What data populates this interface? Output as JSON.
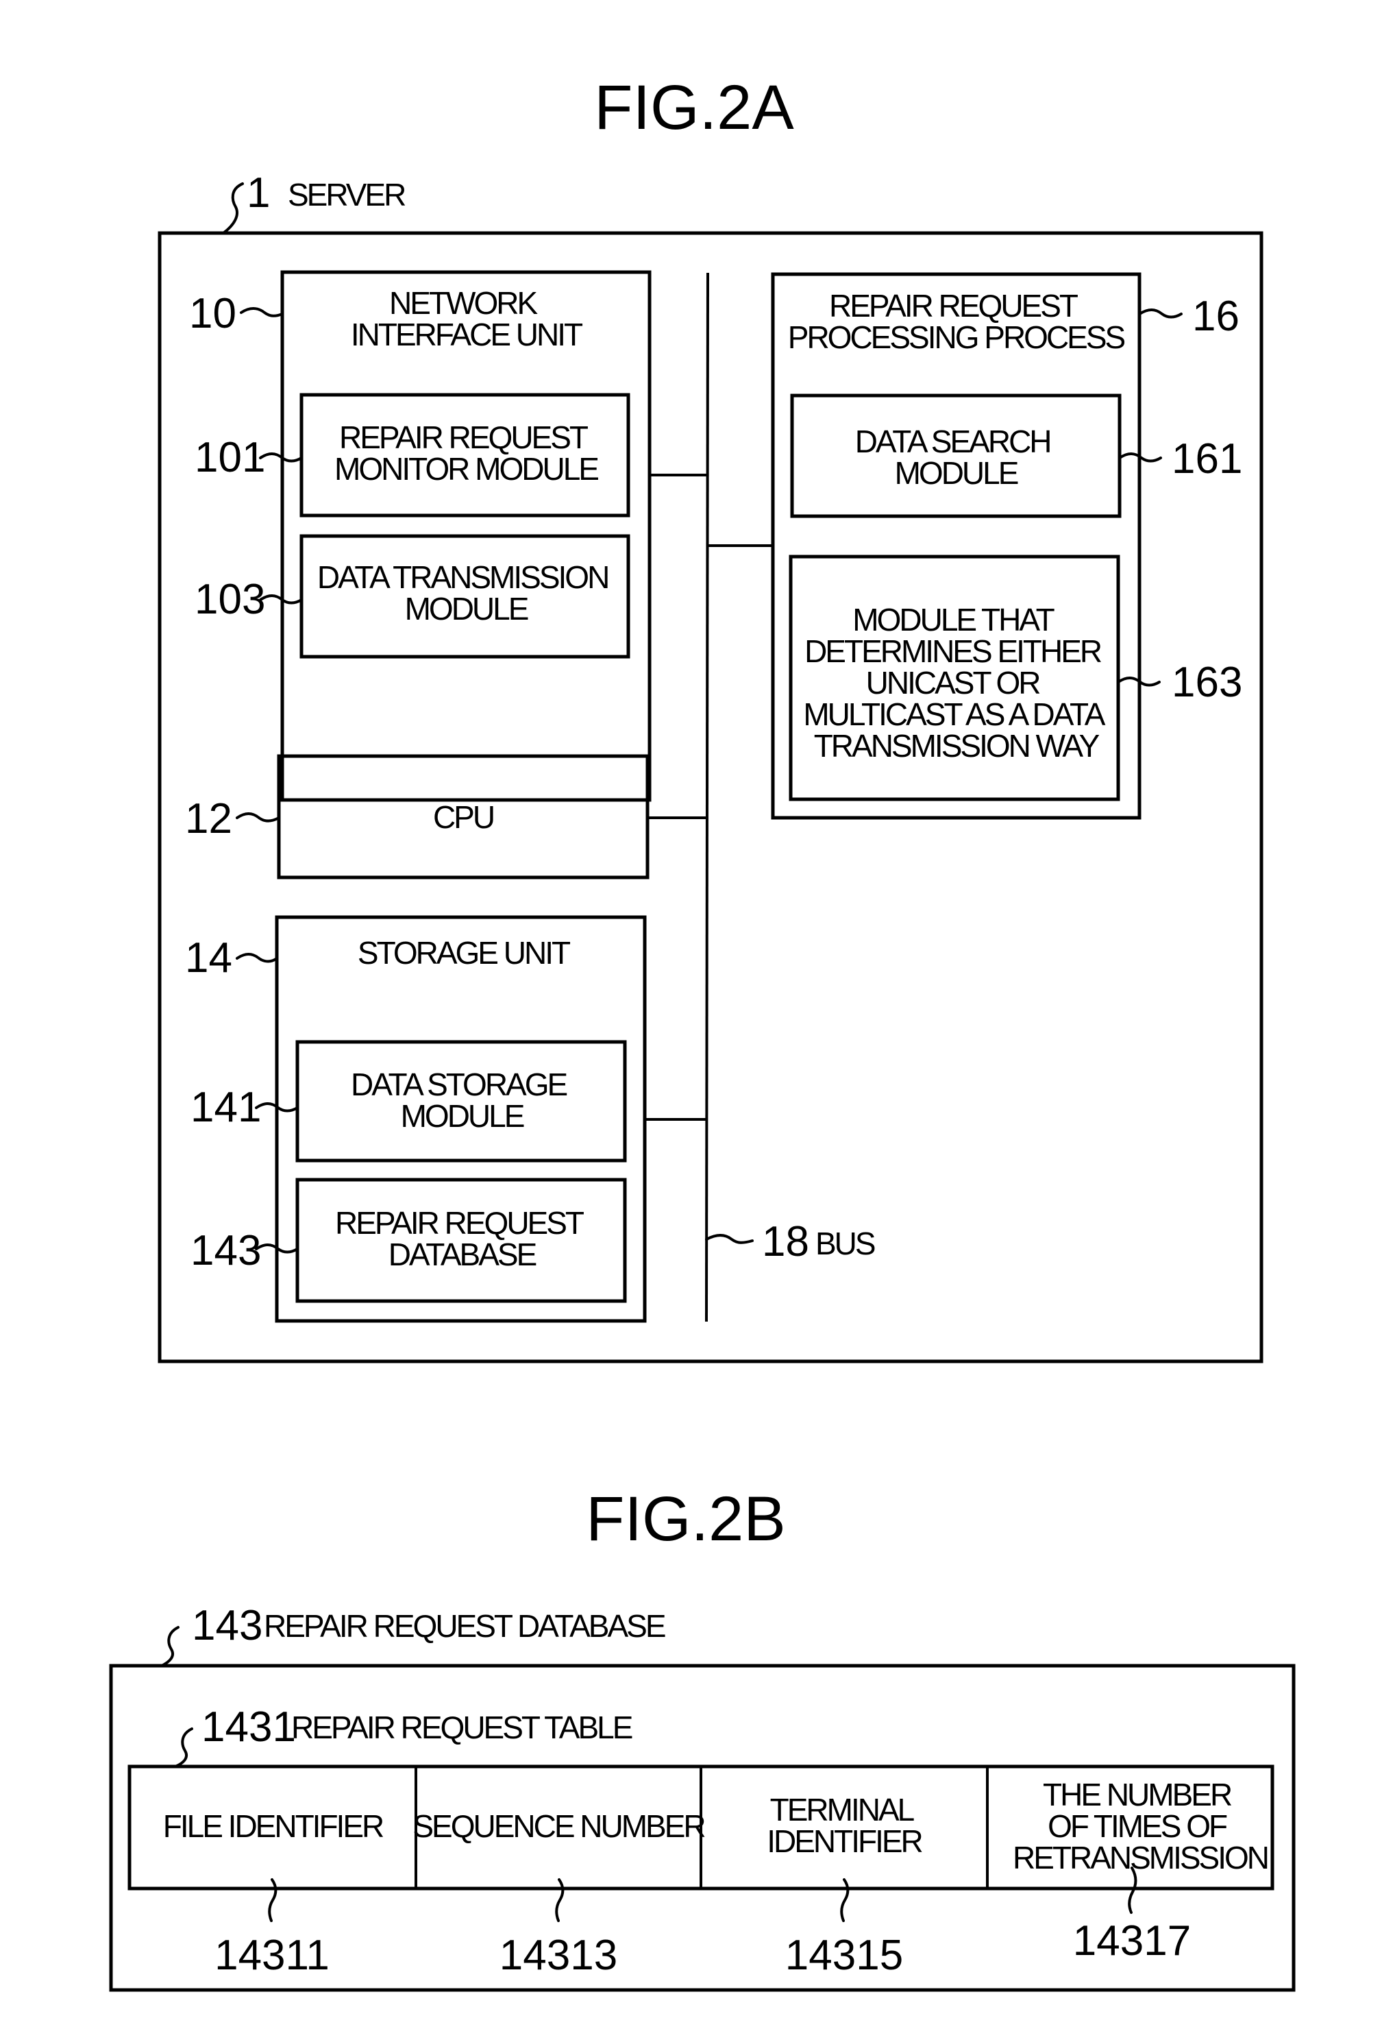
{
  "fig2a": {
    "title": "FIG.2A",
    "server": {
      "ref": "1",
      "label": "SERVER"
    },
    "network_interface_unit": {
      "ref": "10",
      "label_lines": [
        "NETWORK",
        "INTERFACE UNIT"
      ],
      "modules": [
        {
          "ref": "101",
          "label_lines": [
            "REPAIR REQUEST",
            "MONITOR MODULE"
          ]
        },
        {
          "ref": "103",
          "label_lines": [
            "DATA TRANSMISSION",
            "MODULE"
          ]
        }
      ]
    },
    "cpu": {
      "ref": "12",
      "label": "CPU"
    },
    "storage_unit": {
      "ref": "14",
      "label": "STORAGE UNIT",
      "modules": [
        {
          "ref": "141",
          "label_lines": [
            "DATA STORAGE",
            "MODULE"
          ]
        },
        {
          "ref": "143",
          "label_lines": [
            "REPAIR REQUEST",
            "DATABASE"
          ]
        }
      ]
    },
    "repair_request_processing_process": {
      "ref": "16",
      "label_lines": [
        "REPAIR REQUEST",
        "PROCESSING PROCESS"
      ],
      "modules": [
        {
          "ref": "161",
          "label_lines": [
            "DATA SEARCH",
            "MODULE"
          ]
        },
        {
          "ref": "163",
          "label_lines": [
            "MODULE THAT",
            "DETERMINES EITHER",
            "UNICAST OR",
            "MULTICAST AS A DATA",
            "TRANSMISSION WAY"
          ]
        }
      ]
    },
    "bus": {
      "ref": "18",
      "label": "BUS"
    }
  },
  "fig2b": {
    "title": "FIG.2B",
    "database": {
      "ref": "143",
      "label": "REPAIR REQUEST DATABASE"
    },
    "table": {
      "ref": "1431",
      "label": "REPAIR REQUEST TABLE",
      "columns": [
        {
          "ref": "14311",
          "label_lines": [
            "FILE IDENTIFIER"
          ]
        },
        {
          "ref": "14313",
          "label_lines": [
            "SEQUENCE NUMBER"
          ]
        },
        {
          "ref": "14315",
          "label_lines": [
            "TERMINAL",
            "IDENTIFIER"
          ]
        },
        {
          "ref": "14317",
          "label_lines": [
            "THE NUMBER",
            "OF TIMES OF",
            "RETRANSMISSION"
          ]
        }
      ]
    }
  }
}
